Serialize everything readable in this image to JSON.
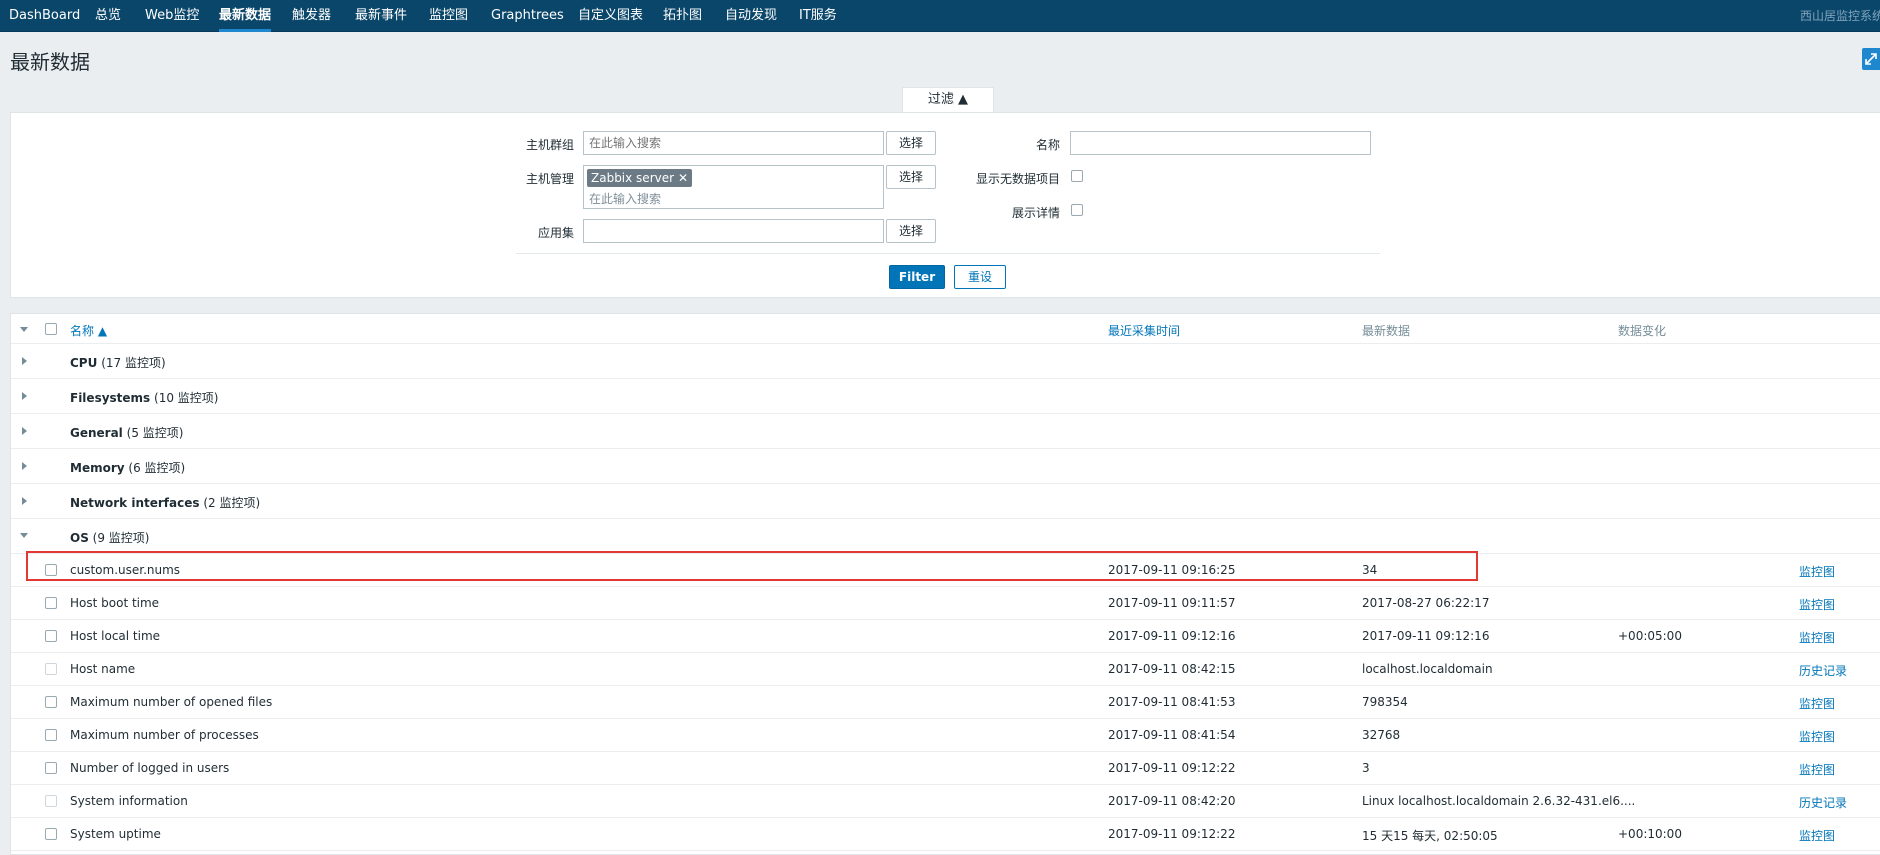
{
  "topnav": {
    "items": [
      "DashBoard",
      "总览",
      "Web监控",
      "最新数据",
      "触发器",
      "最新事件",
      "监控图",
      "Graphtrees",
      "自定义图表",
      "拓扑图",
      "自动发现",
      "IT服务"
    ],
    "active_index": 3,
    "brand": "西山居监控系统"
  },
  "page": {
    "title": "最新数据",
    "fullscreen_icon": "fullscreen-icon"
  },
  "filter": {
    "tab_label": "过滤 ▲",
    "host_groups_label": "主机群组",
    "host_groups_placeholder": "在此输入搜索",
    "hosts_label": "主机管理",
    "hosts_tag": "Zabbix server",
    "hosts_tag_remove": "✕",
    "hosts_placeholder": "在此输入搜索",
    "applications_label": "应用集",
    "applications_value": "",
    "select_label": "选择",
    "name_label": "名称",
    "name_value": "",
    "show_no_data_label": "显示无数据项目",
    "show_details_label": "展示详情",
    "filter_button": "Filter",
    "reset_button": "重设"
  },
  "table": {
    "headers": {
      "name": "名称 ▲",
      "last_check": "最近采集时间",
      "last_value": "最新数据",
      "change": "数据变化"
    },
    "groups": [
      {
        "name": "CPU",
        "count": "(17 监控项)"
      },
      {
        "name": "Filesystems",
        "count": "(10 监控项)"
      },
      {
        "name": "General",
        "count": "(5 监控项)"
      },
      {
        "name": "Memory",
        "count": "(6 监控项)"
      },
      {
        "name": "Network interfaces",
        "count": "(2 监控项)"
      },
      {
        "name": "OS",
        "count": "(9 监控项)"
      }
    ],
    "items": [
      {
        "name": "custom.user.nums",
        "last_check": "2017-09-11 09:16:25",
        "last_value": "34",
        "change": "",
        "action": "监控图"
      },
      {
        "name": "Host boot time",
        "last_check": "2017-09-11 09:11:57",
        "last_value": "2017-08-27 06:22:17",
        "change": "",
        "action": "监控图"
      },
      {
        "name": "Host local time",
        "last_check": "2017-09-11 09:12:16",
        "last_value": "2017-09-11 09:12:16",
        "change": "+00:05:00",
        "action": "监控图"
      },
      {
        "name": "Host name",
        "last_check": "2017-09-11 08:42:15",
        "last_value": "localhost.localdomain",
        "change": "",
        "action": "历史记录"
      },
      {
        "name": "Maximum number of opened files",
        "last_check": "2017-09-11 08:41:53",
        "last_value": "798354",
        "change": "",
        "action": "监控图"
      },
      {
        "name": "Maximum number of processes",
        "last_check": "2017-09-11 08:41:54",
        "last_value": "32768",
        "change": "",
        "action": "监控图"
      },
      {
        "name": "Number of logged in users",
        "last_check": "2017-09-11 09:12:22",
        "last_value": "3",
        "change": "",
        "action": "监控图"
      },
      {
        "name": "System information",
        "last_check": "2017-09-11 08:42:20",
        "last_value": "Linux localhost.localdomain 2.6.32-431.el6....",
        "change": "",
        "action": "历史记录"
      },
      {
        "name": "System uptime",
        "last_check": "2017-09-11 09:12:22",
        "last_value": "15 天15 每天, 02:50:05",
        "change": "+00:10:00",
        "action": "监控图"
      }
    ]
  }
}
